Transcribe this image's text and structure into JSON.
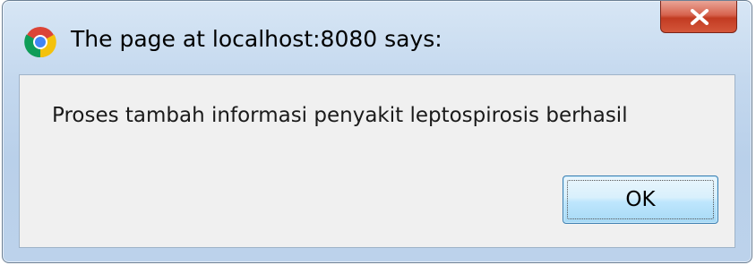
{
  "dialog": {
    "title": "The page at localhost:8080 says:",
    "message": "Proses tambah informasi penyakit leptospirosis berhasil",
    "ok_label": "OK",
    "close_icon": "close-icon",
    "app_icon": "chrome-icon"
  },
  "colors": {
    "close_button": "#c8452e",
    "title_bar": "#c4d8ee",
    "content_bg": "#f0f0f0",
    "ok_border": "#3c7fb1"
  }
}
